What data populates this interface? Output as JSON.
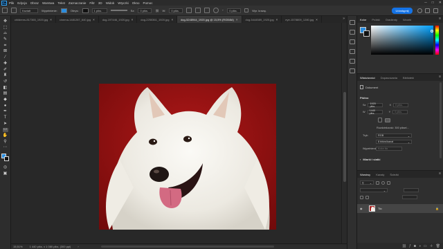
{
  "app": {
    "logo": "Ps"
  },
  "menu": [
    "Plik",
    "Edycja",
    "Obraz",
    "Warstwa",
    "Tekst",
    "Zaznaczanie",
    "Filtr",
    "3D",
    "Widok",
    "Wtyczki",
    "Okno",
    "Pomoc"
  ],
  "window_controls": {
    "minimize": "─",
    "maximize": "□",
    "close": "✕"
  },
  "options": {
    "mode_value": "Kształt",
    "fill_label": "Wypełnienie:",
    "stroke_label": "Obrys:",
    "stroke_width": "1 piks.",
    "w_label": "Sz:",
    "w_value": "0 piks.",
    "h_label": "W:",
    "h_value": "0 piks.",
    "radius_value": "0 piks.",
    "align_edges": "Wyr. krawę.",
    "share_label": "Udostępnij"
  },
  "tabs": [
    {
      "label": "childrens-817365_1920.jpg"
    },
    {
      "label": "cinema-1481287_640.jpg"
    },
    {
      "label": "dog-197446_1920.jpg"
    },
    {
      "label": "dog-2250361_1920.jpg"
    },
    {
      "label": "dog-5248944_1920.jpg @ 15,5% (RGB/8#)",
      "active": true
    },
    {
      "label": "dog-5444589_1920.jpg"
    },
    {
      "label": "eye-1578809_1280.jpg"
    }
  ],
  "status": {
    "zoom": "15,51%",
    "doc_size": "1 440 piks. x 1 080 piks. (300 ppi)"
  },
  "color_panel": {
    "tabs": [
      "Kolor",
      "Próbki",
      "Gradienty",
      "Wzorki"
    ],
    "fg_color": "#2b8ee0",
    "bg_color": "#111111"
  },
  "properties": {
    "tabs": [
      "Właściwości",
      "Dopasowania",
      "Biblioteki"
    ],
    "doc_label": "Dokument",
    "canvas_label": "Płótno",
    "w_label": "Sz",
    "w_value": "1920 piks.",
    "x_label": "X",
    "x_value": "0 piks.",
    "h_label": "W",
    "h_value": "1440 piks.",
    "y_label": "Y",
    "y_value": "0 piks.",
    "resolution": "Rozdzielczość: 300 piksel...",
    "mode_label": "Tryb",
    "mode_value": "RGB",
    "depth_value": "8 bitów/kanał",
    "bg_label": "Wypełnienie",
    "bg_value": "Kolor tła",
    "rulers_label": "Miarki i siatki"
  },
  "layers": {
    "tabs": [
      "Warstwy",
      "Kanały",
      "Ścieżki"
    ],
    "layer_name": "Tło",
    "layer_lock": "🔒"
  }
}
